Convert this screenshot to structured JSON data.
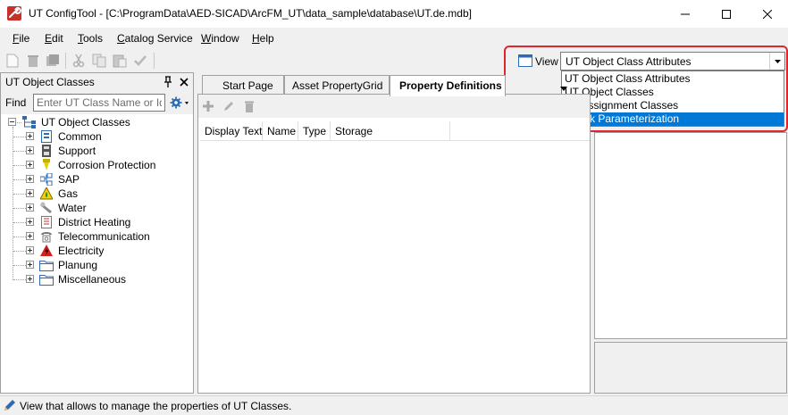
{
  "window": {
    "title": "UT ConfigTool - [C:\\ProgramData\\AED-SICAD\\ArcFM_UT\\data_sample\\database\\UT.de.mdb]"
  },
  "menu": [
    {
      "accel": "F",
      "rest": "ile"
    },
    {
      "accel": "E",
      "rest": "dit"
    },
    {
      "accel": "T",
      "rest": "ools"
    },
    {
      "accel": "C",
      "rest": "atalog Service"
    },
    {
      "accel": "W",
      "rest": "indow"
    },
    {
      "accel": "H",
      "rest": "elp"
    }
  ],
  "view": {
    "label": "View",
    "selected": "UT Object Class Attributes",
    "options": [
      "UT Object Class Attributes",
      "UT Object Classes",
      "UT Assignment Classes",
      "Check Parameterization"
    ],
    "highlighted_option": "Check Parameterization"
  },
  "left_panel": {
    "title": "UT Object Classes",
    "find_label": "Find",
    "find_placeholder": "Enter UT Class Name or Identifier",
    "find_value": "",
    "tree_root": "UT Object Classes",
    "tree_items": [
      {
        "label": "Common",
        "icon": "common-icon"
      },
      {
        "label": "Support",
        "icon": "support-icon"
      },
      {
        "label": "Corrosion Protection",
        "icon": "corrosion-icon"
      },
      {
        "label": "SAP",
        "icon": "sap-icon"
      },
      {
        "label": "Gas",
        "icon": "gas-icon"
      },
      {
        "label": "Water",
        "icon": "water-icon"
      },
      {
        "label": "District Heating",
        "icon": "heating-icon"
      },
      {
        "label": "Telecommunication",
        "icon": "telephone-icon"
      },
      {
        "label": "Electricity",
        "icon": "electricity-icon"
      },
      {
        "label": "Planung",
        "icon": "folder-icon"
      },
      {
        "label": "Miscellaneous",
        "icon": "folder-icon"
      }
    ]
  },
  "tabs": [
    {
      "label": "Start Page",
      "active": false
    },
    {
      "label": "Asset PropertyGrid",
      "active": false
    },
    {
      "label": "Property Definitions",
      "active": true
    }
  ],
  "grid": {
    "columns": [
      "Display Text",
      "Name",
      "Type",
      "Storage"
    ]
  },
  "status": {
    "text": "View that allows to manage the properties of UT Classes."
  },
  "colors": {
    "highlight_border": "#e0262c",
    "selection": "#0078d7"
  }
}
